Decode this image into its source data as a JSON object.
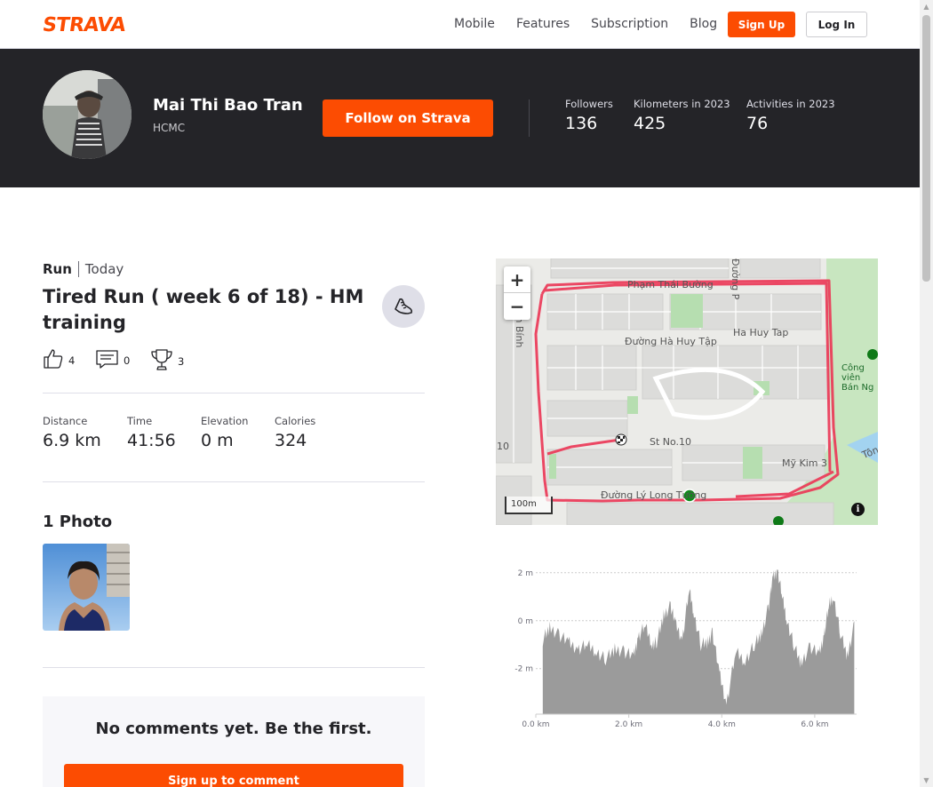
{
  "nav": {
    "logo": "STRAVA",
    "links": [
      "Mobile",
      "Features",
      "Subscription",
      "Blog"
    ],
    "signup_label": "Sign Up",
    "login_label": "Log In"
  },
  "athlete": {
    "name": "Mai Thi Bao Tran",
    "location": "HCMC",
    "follow_label": "Follow on Strava",
    "stats": [
      {
        "label": "Followers",
        "value": "136"
      },
      {
        "label": "Kilometers in 2023",
        "value": "425"
      },
      {
        "label": "Activities in 2023",
        "value": "76"
      }
    ]
  },
  "activity": {
    "type": "Run",
    "when": "Today",
    "title": "Tired Run ( week 6 of 18) - HM training",
    "kudos": "4",
    "comments": "0",
    "achievements": "3",
    "stats": [
      {
        "label": "Distance",
        "value": "6.9 km"
      },
      {
        "label": "Time",
        "value": "41:56"
      },
      {
        "label": "Elevation",
        "value": "0 m"
      },
      {
        "label": "Calories",
        "value": "324"
      }
    ],
    "photos_title": "1 Photo"
  },
  "comments": {
    "empty_message": "No comments yet. Be the first.",
    "signup_label": "Sign up to comment"
  },
  "map": {
    "zoom_in": "+",
    "zoom_out": "−",
    "scale": "100m",
    "info": "i",
    "labels": [
      "Phạm Thái Bường",
      "Đường Hà Huy Tập",
      "Ha Huy Tap",
      "St No.10",
      "Mỹ Kim 3",
      "Đường Lý Long Tường",
      "Nguyễn Bính",
      "Đường P",
      "Công viên Bán Ng",
      "Tôn",
      "10"
    ]
  },
  "chart_data": {
    "type": "area",
    "title": "",
    "xlabel": "",
    "ylabel": "",
    "x_ticks": [
      "0.0 km",
      "2.0 km",
      "4.0 km",
      "6.0 km"
    ],
    "y_ticks": [
      "2 m",
      "0 m",
      "-2 m"
    ],
    "xlim": [
      0,
      6.9
    ],
    "ylim": [
      -3.9,
      2.4
    ],
    "series": [
      {
        "x": [
          0.15,
          0.3,
          0.5,
          0.7,
          0.9,
          1.1,
          1.3,
          1.5,
          1.7,
          1.9,
          2.1,
          2.2,
          2.35,
          2.5,
          2.6,
          2.75,
          2.9,
          3.0,
          3.15,
          3.3,
          3.4,
          3.55,
          3.7,
          3.8,
          3.95,
          4.1,
          4.3,
          4.5,
          4.7,
          4.85,
          5.0,
          5.1,
          5.2,
          5.3,
          5.4,
          5.55,
          5.7,
          5.9,
          6.1,
          6.2,
          6.3,
          6.4,
          6.55,
          6.7,
          6.85
        ],
        "values": [
          -0.8,
          -0.3,
          -0.6,
          -0.9,
          -1.2,
          -1.0,
          -1.3,
          -1.6,
          -1.2,
          -1.3,
          -1.5,
          -0.7,
          -0.2,
          -1.0,
          -0.9,
          0.2,
          0.6,
          -0.1,
          -0.8,
          1.3,
          0.3,
          -1.0,
          -0.9,
          -0.5,
          -2.2,
          -3.5,
          -1.3,
          -1.7,
          -1.0,
          -0.6,
          0.5,
          1.8,
          2.1,
          1.0,
          0.0,
          -1.0,
          -1.8,
          -1.1,
          -1.4,
          -0.6,
          0.6,
          1.0,
          -0.5,
          -1.5,
          -0.2
        ]
      }
    ]
  }
}
